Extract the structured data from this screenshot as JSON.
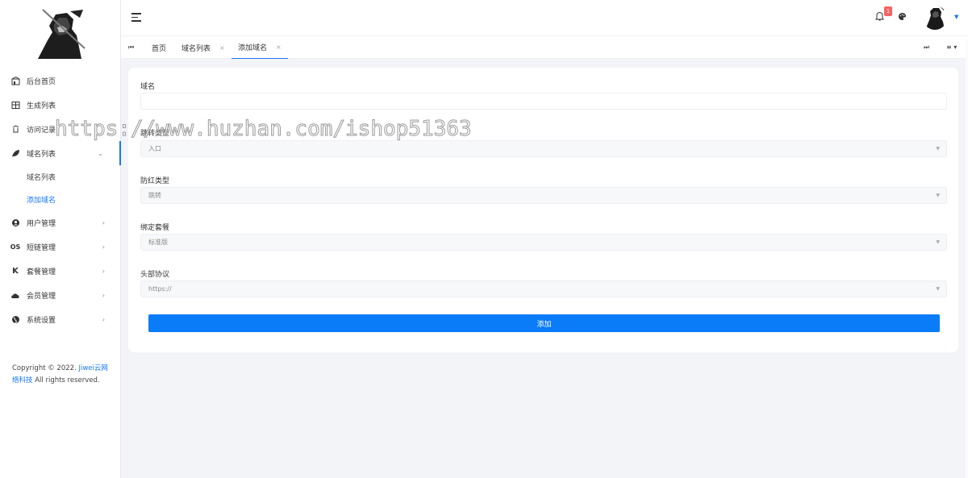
{
  "sidebar": {
    "items": [
      {
        "label": "后台首页",
        "icon": "home-icon"
      },
      {
        "label": "生成列表",
        "icon": "table-icon"
      },
      {
        "label": "访问记录",
        "icon": "log-icon"
      },
      {
        "label": "域名列表",
        "icon": "leaf-icon",
        "open": true
      },
      {
        "label": "用户管理",
        "icon": "user-icon"
      },
      {
        "label": "短链管理",
        "icon": "link-icon"
      },
      {
        "label": "套餐管理",
        "icon": "package-icon"
      },
      {
        "label": "会员管理",
        "icon": "cloud-icon"
      },
      {
        "label": "系统设置",
        "icon": "globe-icon"
      }
    ],
    "subitems": [
      {
        "label": "域名列表"
      },
      {
        "label": "添加域名",
        "active": true
      }
    ],
    "copyright": {
      "prefix": "Copyright © 2022. ",
      "link": "Jiwei云网络科技",
      "suffix": " All rights reserved."
    }
  },
  "topbar": {
    "notification_count": "1"
  },
  "tabs": [
    {
      "label": "首页"
    },
    {
      "label": "域名列表",
      "close": "×"
    },
    {
      "label": "添加域名",
      "close": "×",
      "active": true
    }
  ],
  "form": {
    "fields": [
      {
        "label": "域名",
        "type": "input",
        "value": ""
      },
      {
        "label": "跳转类型",
        "type": "select",
        "value": "入口"
      },
      {
        "label": "防红类型",
        "type": "select",
        "value": "跳转"
      },
      {
        "label": "绑定套餐",
        "type": "select",
        "value": "标准版"
      },
      {
        "label": "头部协议",
        "type": "select",
        "value": "https://"
      }
    ],
    "submit_label": "添加"
  },
  "watermark": "https://www.huzhan.com/ishop51363",
  "colors": {
    "accent": "#1678f6",
    "button": "#0b7cf7",
    "badge": "#f56262"
  }
}
